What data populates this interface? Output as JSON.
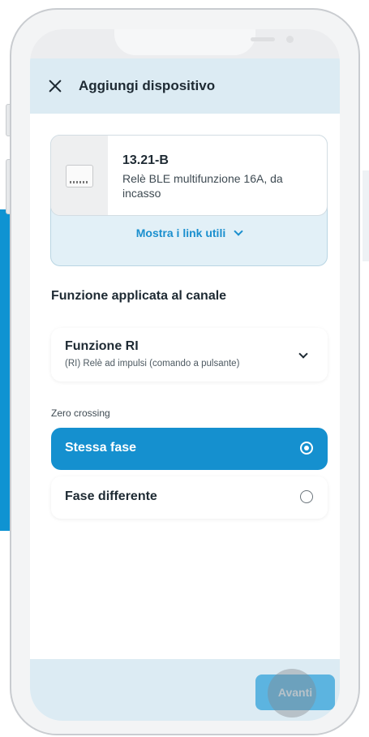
{
  "header": {
    "title": "Aggiungi dispositivo",
    "close_icon": "close-icon"
  },
  "device": {
    "model": "13.21-B",
    "description": "Relè BLE multifunzione 16A, da incasso",
    "links_label": "Mostra i link utili"
  },
  "channel": {
    "section_title": "Funzione applicata al canale",
    "function_name": "Funzione RI",
    "function_desc": "(RI) Relè ad impulsi (comando a pulsante)"
  },
  "zero_crossing": {
    "label": "Zero crossing",
    "options": [
      {
        "label": "Stessa fase",
        "selected": true
      },
      {
        "label": "Fase differente",
        "selected": false
      }
    ]
  },
  "footer": {
    "next_label": "Avanti"
  },
  "colors": {
    "accent": "#1590cf",
    "header_bg": "#dcebf3",
    "button_disabled": "#5cb4e0"
  }
}
